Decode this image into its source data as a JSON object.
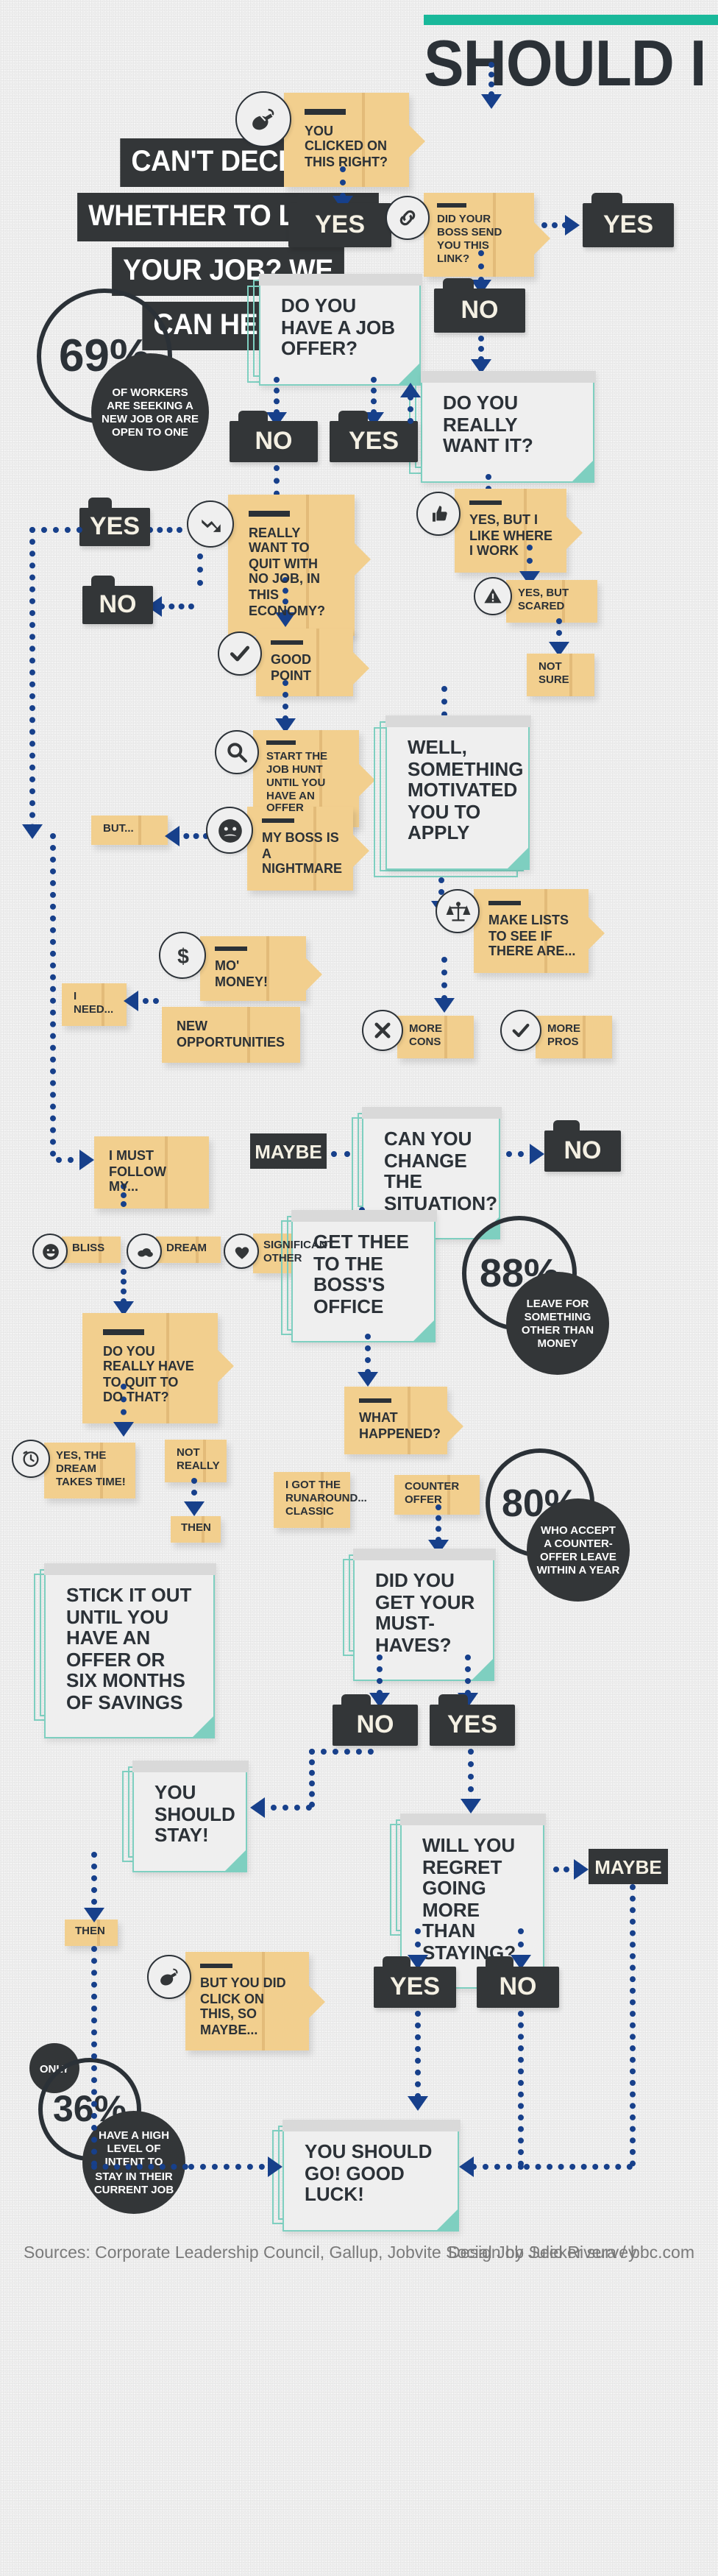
{
  "title": "SHOULD I QUIT?",
  "headline": [
    "CAN'T DECIDE",
    "WHETHER TO LEAVE",
    "YOUR JOB? WE",
    "CAN HELP!"
  ],
  "colors": {
    "accent_teal": "#19b89a",
    "note_tan": "#f2cf8e",
    "dark": "#333638",
    "connector_blue": "#17408b",
    "card_border": "#7ecfc0",
    "background": "#eeeeee"
  },
  "stats": [
    {
      "id": "stat-69",
      "value": "69%",
      "caption": "OF WORKERS ARE SEEKING A NEW JOB OR ARE OPEN TO ONE"
    },
    {
      "id": "stat-88",
      "value": "88%",
      "caption": "LEAVE FOR SOMETHING OTHER THAN MONEY"
    },
    {
      "id": "stat-80",
      "value": "80%",
      "caption": "WHO ACCEPT A COUNTER-OFFER LEAVE WITHIN A YEAR"
    },
    {
      "id": "stat-36",
      "prefix": "ONLY",
      "value": "36%",
      "caption": "HAVE A HIGH LEVEL OF INTENT TO STAY IN THEIR CURRENT JOB"
    }
  ],
  "notes": [
    {
      "id": "note-clicked",
      "text": "YOU CLICKED ON THIS RIGHT?",
      "icon": "mouse-icon"
    },
    {
      "id": "note-boss-link",
      "text": "DID YOUR BOSS SEND YOU THIS LINK?",
      "icon": "link-icon"
    },
    {
      "id": "note-really-want",
      "text": "REALLY WANT TO QUIT WITH NO JOB, IN THIS ECONOMY?",
      "icon": "down-arrow-icon"
    },
    {
      "id": "note-like-work",
      "text": "YES, BUT I LIKE WHERE I WORK",
      "icon": "thumbs-up-icon"
    },
    {
      "id": "note-scared",
      "text": "YES, BUT SCARED",
      "icon": "warning-icon"
    },
    {
      "id": "note-not-sure",
      "text": "NOT SURE",
      "icon": "none"
    },
    {
      "id": "note-good-point",
      "text": "GOOD POINT",
      "icon": "check-icon"
    },
    {
      "id": "note-job-hunt",
      "text": "START THE JOB HUNT UNTIL YOU HAVE AN OFFER",
      "icon": "search-icon"
    },
    {
      "id": "note-but",
      "text": "BUT...",
      "icon": "none"
    },
    {
      "id": "note-nightmare",
      "text": "MY BOSS IS A NIGHTMARE",
      "icon": "angry-face-icon"
    },
    {
      "id": "note-make-lists",
      "text": "MAKE LISTS TO SEE IF THERE ARE...",
      "icon": "scales-icon"
    },
    {
      "id": "note-i-need",
      "text": "I NEED...",
      "icon": "none"
    },
    {
      "id": "note-mo-money",
      "text": "MO' MONEY!",
      "icon": "dollar-icon"
    },
    {
      "id": "note-new-opps",
      "text": "NEW OPPORTUNITIES",
      "icon": "none"
    },
    {
      "id": "note-more-cons",
      "text": "MORE CONS",
      "icon": "x-icon"
    },
    {
      "id": "note-more-pros",
      "text": "MORE PROS",
      "icon": "check-icon"
    },
    {
      "id": "note-follow-my",
      "text": "I MUST FOLLOW MY...",
      "icon": "none"
    },
    {
      "id": "note-bliss",
      "text": "BLISS",
      "icon": "smile-icon"
    },
    {
      "id": "note-dream",
      "text": "DREAM",
      "icon": "cloud-icon"
    },
    {
      "id": "note-sig-other",
      "text": "SIGNIFICANT OTHER",
      "icon": "heart-icon"
    },
    {
      "id": "note-have-to-quit",
      "text": "DO YOU REALLY HAVE TO QUIT TO DO THAT?",
      "icon": "none"
    },
    {
      "id": "note-dream-time",
      "text": "YES, THE DREAM TAKES TIME!",
      "icon": "clock-icon"
    },
    {
      "id": "note-not-really",
      "text": "NOT REALLY",
      "icon": "none"
    },
    {
      "id": "note-then-1",
      "text": "THEN",
      "icon": "none"
    },
    {
      "id": "note-what-happened",
      "text": "WHAT HAPPENED?",
      "icon": "none"
    },
    {
      "id": "note-runaround",
      "text": "I GOT THE RUNAROUND... CLASSIC",
      "icon": "none"
    },
    {
      "id": "note-counter",
      "text": "COUNTER OFFER",
      "icon": "none"
    },
    {
      "id": "note-then-2",
      "text": "THEN",
      "icon": "none"
    },
    {
      "id": "note-but-clicked",
      "text": "BUT YOU DID CLICK ON THIS, SO MAYBE...",
      "icon": "mouse-icon"
    }
  ],
  "questions": [
    {
      "id": "q-job-offer",
      "text": "DO YOU HAVE A JOB OFFER?"
    },
    {
      "id": "q-really-want",
      "text": "DO YOU REALLY WANT IT?"
    },
    {
      "id": "q-motivated",
      "text": "WELL, SOMETHING MOTIVATED YOU TO APPLY"
    },
    {
      "id": "q-change",
      "text": "CAN YOU CHANGE THE SITUATION?"
    },
    {
      "id": "q-boss-office",
      "text": "GET THEE TO THE BOSS'S OFFICE"
    },
    {
      "id": "q-must-haves",
      "text": "DID YOU GET YOUR MUST-HAVES?"
    },
    {
      "id": "q-stick-it-out",
      "text": "STICK IT OUT UNTIL YOU HAVE AN OFFER OR SIX MONTHS OF SAVINGS"
    },
    {
      "id": "q-should-stay",
      "text": "YOU SHOULD STAY!"
    },
    {
      "id": "q-regret",
      "text": "WILL YOU REGRET GOING MORE THAN STAYING?"
    },
    {
      "id": "q-should-go",
      "text": "YOU SHOULD GO! GOOD LUCK!"
    }
  ],
  "answers": {
    "yes": "YES",
    "no": "NO",
    "maybe": "MAYBE"
  },
  "footer": {
    "sources": "Sources: Corporate Leadership Council, Gallup, Jobvite Social Job Seeker survey",
    "credit": "Design by Julio Rivera / bbc.com"
  }
}
